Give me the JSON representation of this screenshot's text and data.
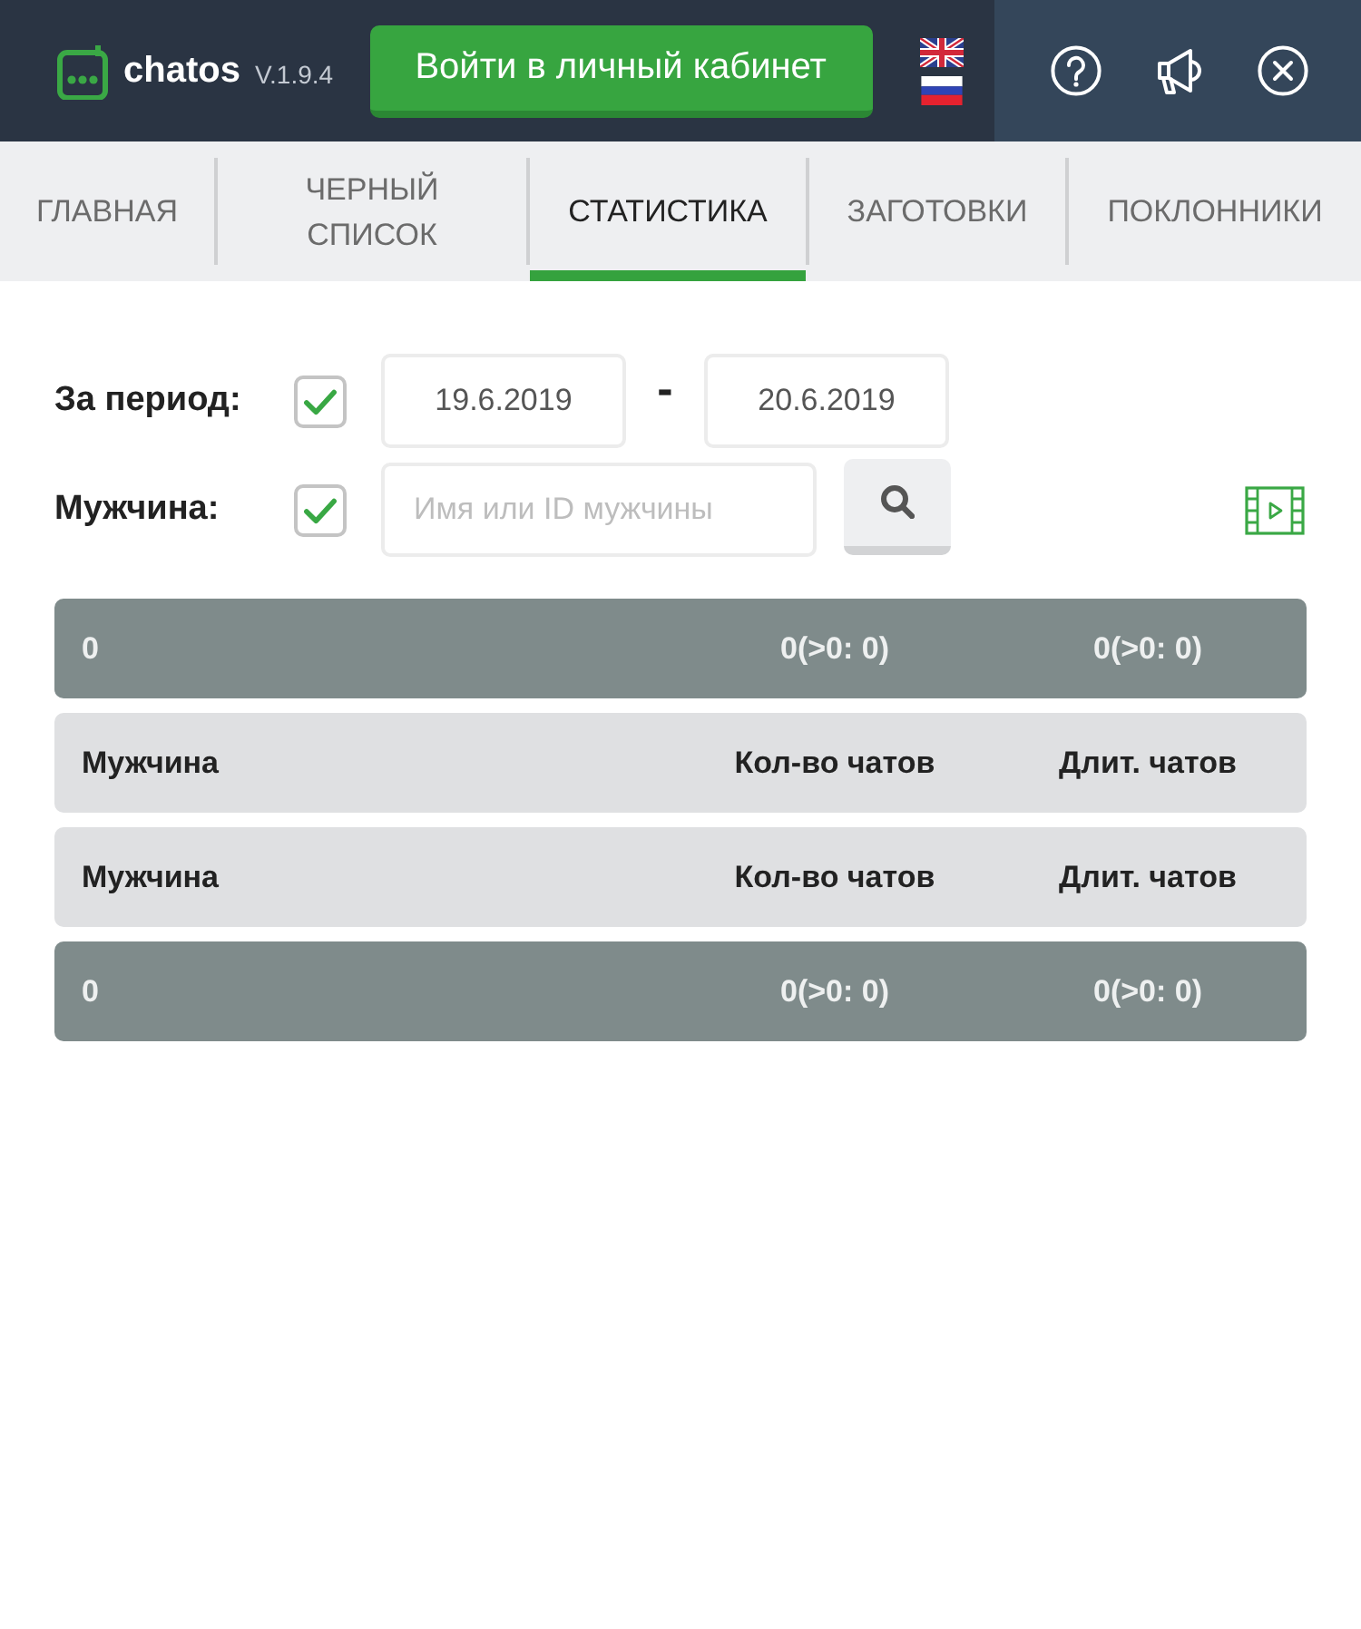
{
  "header": {
    "app_name": "chatos",
    "version": "V.1.9.4",
    "login_button": "Войти в личный кабинет"
  },
  "tabs": [
    {
      "label": "ГЛАВНАЯ",
      "selected": false
    },
    {
      "label": "ЧЕРНЫЙ СПИСОК",
      "selected": false
    },
    {
      "label": "СТАТИСТИКА",
      "selected": true
    },
    {
      "label": "ЗАГОТОВКИ",
      "selected": false
    },
    {
      "label": "ПОКЛОННИКИ",
      "selected": false
    }
  ],
  "filters": [
    {
      "kind": "date_range",
      "label": "За период:",
      "checked": true,
      "from": "19.6.2019",
      "separator": "-",
      "to": "20.6.2019"
    },
    {
      "kind": "search",
      "label": "Мужчина:",
      "checked": true,
      "placeholder": "Имя или ID мужчины"
    }
  ],
  "table": {
    "rows": [
      {
        "kind": "total",
        "cells": [
          "0",
          "0(>0: 0)",
          "0(>0: 0)"
        ]
      },
      {
        "kind": "header",
        "cells": [
          "Мужчина",
          "Кол-во чатов",
          "Длит. чатов"
        ]
      },
      {
        "kind": "header",
        "cells": [
          "Мужчина",
          "Кол-во чатов",
          "Длит. чатов"
        ]
      },
      {
        "kind": "total",
        "cells": [
          "0",
          "0(>0: 0)",
          "0(>0: 0)"
        ]
      }
    ]
  }
}
